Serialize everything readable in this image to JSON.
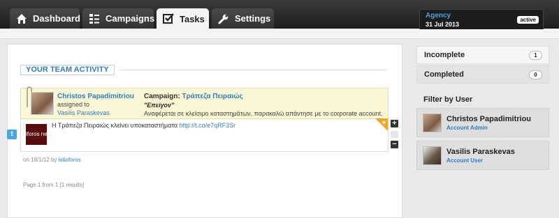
{
  "nav": {
    "tabs": [
      {
        "label": "Dashboard",
        "icon": "home-icon"
      },
      {
        "label": "Campaigns",
        "icon": "list-icon"
      },
      {
        "label": "Tasks",
        "icon": "checkbox-icon",
        "active": true
      },
      {
        "label": "Settings",
        "icon": "wrench-icon"
      }
    ],
    "agency": {
      "name": "Agency",
      "date": "31 Jul 2013",
      "status": "active"
    }
  },
  "main": {
    "section_title": "YOUR TEAM ACTIVITY",
    "task": {
      "assigner": "Christos Papadimitriou",
      "assigned_text": "assigned to",
      "assignee": "Vasilis Paraskevas",
      "campaign_label": "Campaign:",
      "campaign_name": "Τράπεζα Πειραιώς",
      "status": "\"Επείγον\"",
      "note": "Αναφέρεται σε κλείσιμο καταστημάτων, παρακαλώ απάντησε με το corporate account."
    },
    "post": {
      "thumb_text": "iforos ne",
      "text": "Η Τράπεζα Πειραιώς κλείνει υποκαταστήματα",
      "link": "http://t.co/e7qRF3Sr",
      "source_icon": "twitter-icon"
    },
    "meta": {
      "prefix": "on 18/1/12 by",
      "author": "istioforos"
    },
    "pager": "Page 1 from 1 [1 results]"
  },
  "sidebar": {
    "filters": [
      {
        "label": "Incomplete",
        "count": "1"
      },
      {
        "label": "Completed",
        "count": "0"
      }
    ],
    "filter_title": "Filter by User",
    "users": [
      {
        "name": "Christos Papadimitriou",
        "role": "Account Admin"
      },
      {
        "name": "Vasilis Paraskevas",
        "role": "Account User"
      }
    ]
  },
  "colors": {
    "accent": "#2f7fc1",
    "task_bg": "#fbf7d4",
    "topbar": "#2a2a2a",
    "star": "#f3a623"
  }
}
